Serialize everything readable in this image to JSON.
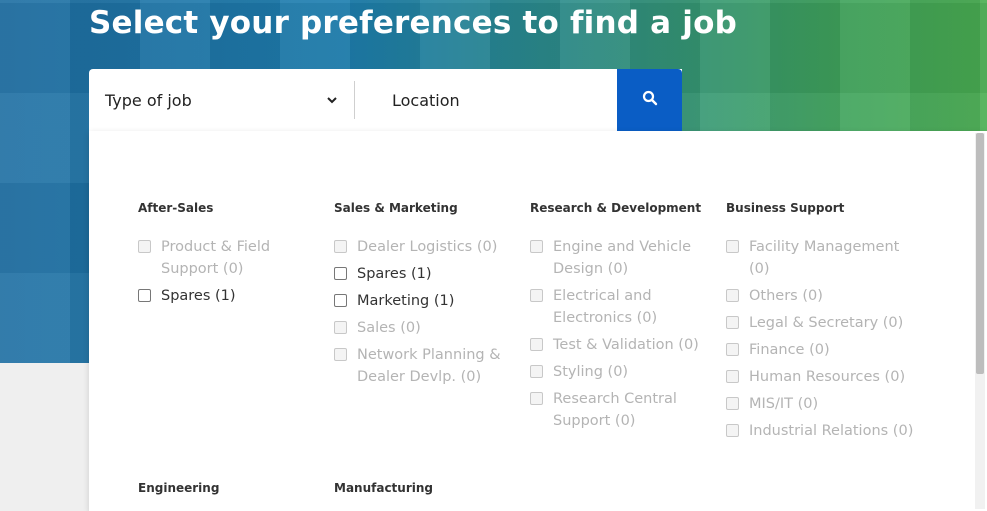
{
  "hero": {
    "title": "Select your preferences to find a job"
  },
  "search": {
    "type_label": "Type of job",
    "location_label": "Location"
  },
  "categories": [
    {
      "title": "After-Sales",
      "options": [
        {
          "label": "Product & Field Support (0)",
          "enabled": false
        },
        {
          "label": "Spares (1)",
          "enabled": true
        }
      ]
    },
    {
      "title": "Sales & Marketing",
      "options": [
        {
          "label": "Dealer Logistics (0)",
          "enabled": false
        },
        {
          "label": "Spares (1)",
          "enabled": true
        },
        {
          "label": "Marketing (1)",
          "enabled": true
        },
        {
          "label": "Sales (0)",
          "enabled": false
        },
        {
          "label": "Network Planning & Dealer Devlp. (0)",
          "enabled": false
        }
      ]
    },
    {
      "title": "Research & Development",
      "options": [
        {
          "label": "Engine and Vehicle Design (0)",
          "enabled": false
        },
        {
          "label": "Electrical and Electronics (0)",
          "enabled": false
        },
        {
          "label": "Test & Validation (0)",
          "enabled": false
        },
        {
          "label": "Styling (0)",
          "enabled": false
        },
        {
          "label": "Research Central Support (0)",
          "enabled": false
        }
      ]
    },
    {
      "title": "Business Support",
      "options": [
        {
          "label": "Facility Management (0)",
          "enabled": false
        },
        {
          "label": "Others (0)",
          "enabled": false
        },
        {
          "label": "Legal & Secretary (0)",
          "enabled": false
        },
        {
          "label": "Finance (0)",
          "enabled": false
        },
        {
          "label": "Human Resources (0)",
          "enabled": false
        },
        {
          "label": "MIS/IT (0)",
          "enabled": false
        },
        {
          "label": "Industrial Relations (0)",
          "enabled": false
        }
      ]
    },
    {
      "title": "Engineering",
      "options": []
    },
    {
      "title": "Manufacturing",
      "options": []
    }
  ]
}
